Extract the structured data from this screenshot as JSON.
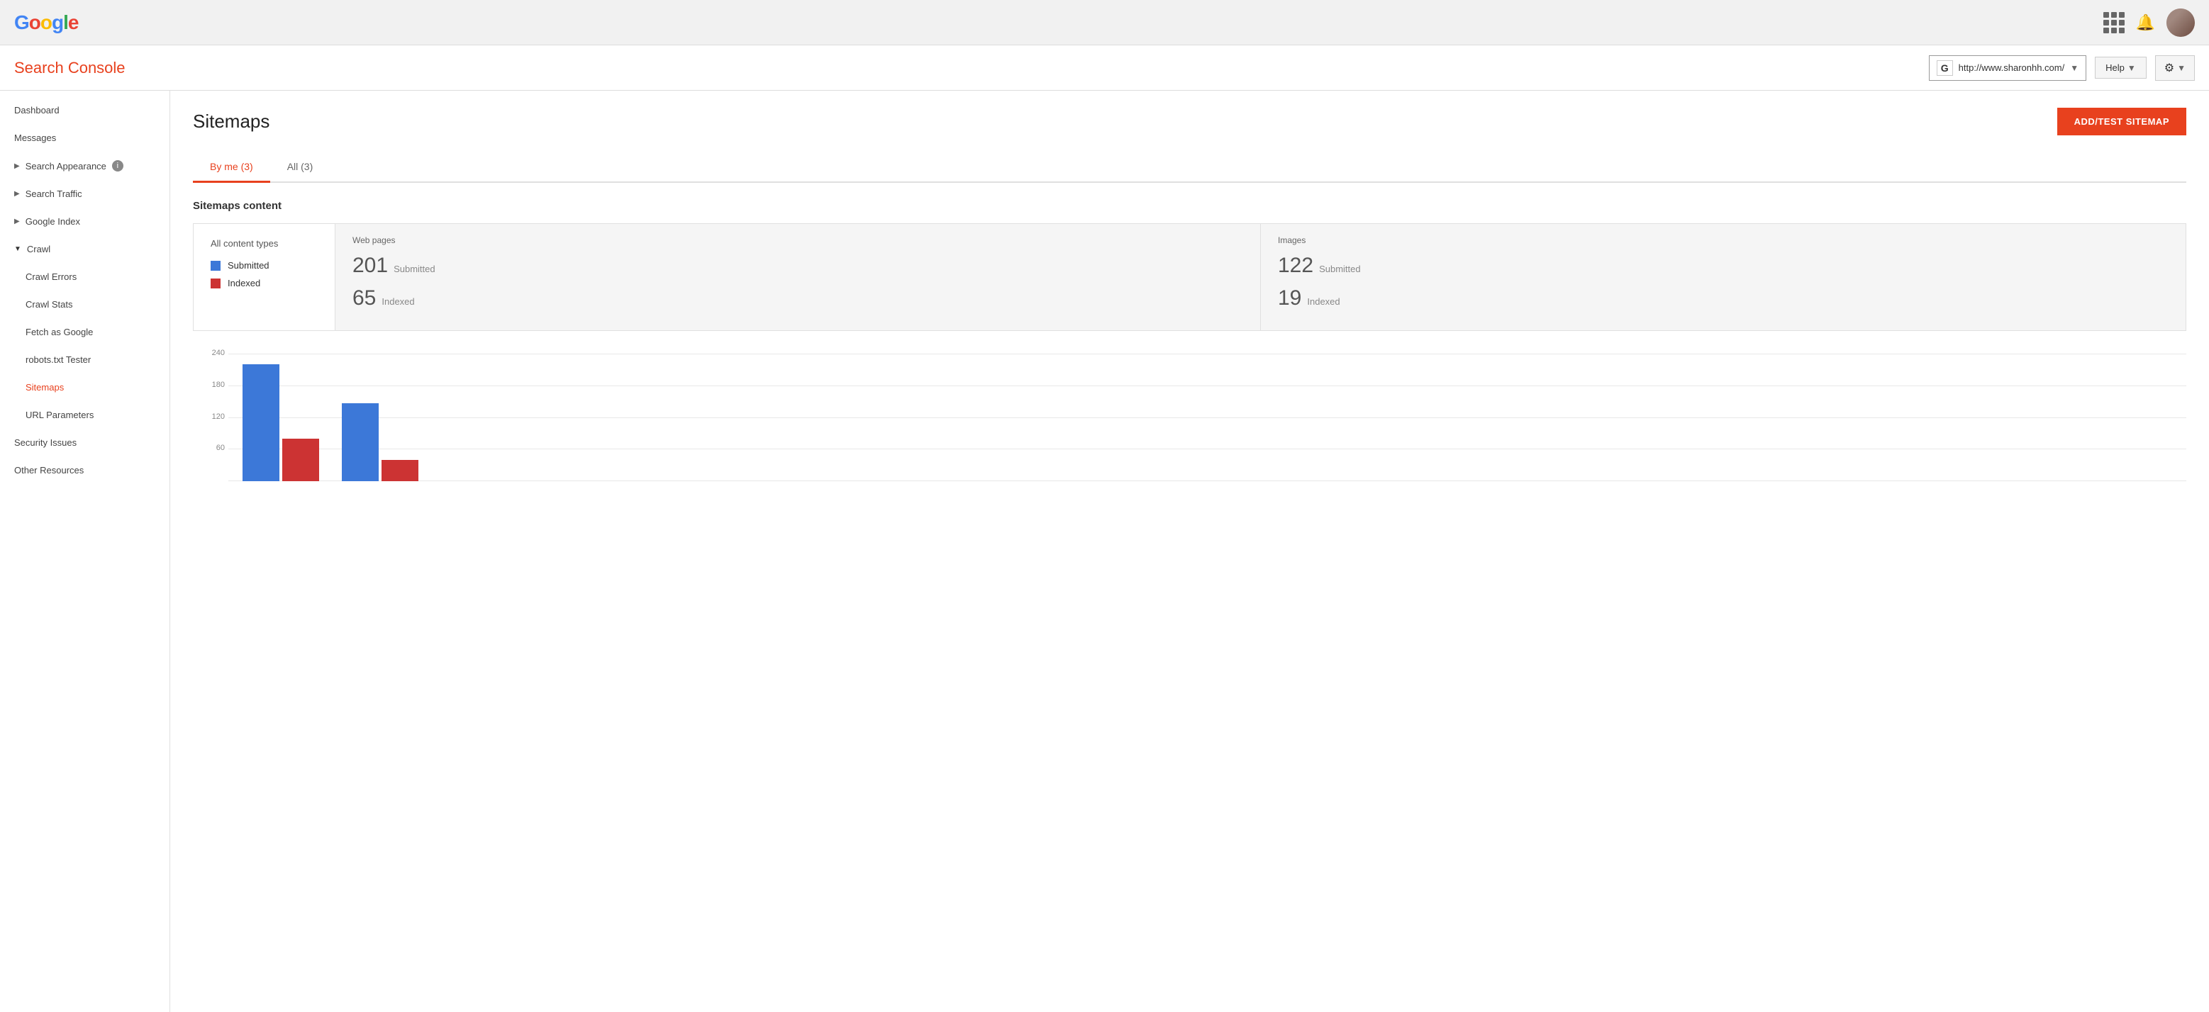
{
  "topbar": {
    "logo": {
      "g1": "G",
      "o1": "o",
      "o2": "o",
      "g2": "g",
      "l": "l",
      "e": "e"
    }
  },
  "header": {
    "title": "Search Console",
    "site_url": "http://www.sharonhh.com/",
    "help_label": "Help",
    "gear_icon": "⚙"
  },
  "sidebar": {
    "dashboard": "Dashboard",
    "messages": "Messages",
    "search_appearance": "Search Appearance",
    "search_traffic": "Search Traffic",
    "google_index": "Google Index",
    "crawl": "Crawl",
    "crawl_errors": "Crawl Errors",
    "crawl_stats": "Crawl Stats",
    "fetch_as_google": "Fetch as Google",
    "robots_txt_tester": "robots.txt Tester",
    "sitemaps": "Sitemaps",
    "url_parameters": "URL Parameters",
    "security_issues": "Security Issues",
    "other_resources": "Other Resources"
  },
  "page": {
    "title": "Sitemaps",
    "add_test_btn": "ADD/TEST SITEMAP"
  },
  "tabs": [
    {
      "label": "By me (3)",
      "active": true
    },
    {
      "label": "All (3)",
      "active": false
    }
  ],
  "sitemaps_content": {
    "section_label": "Sitemaps content",
    "all_content_types": "All content types",
    "submitted_label": "Submitted",
    "indexed_label": "Indexed",
    "web_pages": {
      "type": "Web pages",
      "submitted_count": "201",
      "submitted_label": "Submitted",
      "indexed_count": "65",
      "indexed_label": "Indexed"
    },
    "images": {
      "type": "Images",
      "submitted_count": "122",
      "submitted_label": "Submitted",
      "indexed_count": "19",
      "indexed_label": "Indexed"
    }
  },
  "chart": {
    "y_labels": [
      "240",
      "180",
      "120",
      "60"
    ],
    "bars": [
      {
        "blue_height": 165,
        "red_height": 60
      },
      {
        "blue_height": 110,
        "red_height": 30
      }
    ]
  },
  "colors": {
    "accent": "#e8411e",
    "blue": "#3c78d8",
    "red": "#cc3333"
  }
}
